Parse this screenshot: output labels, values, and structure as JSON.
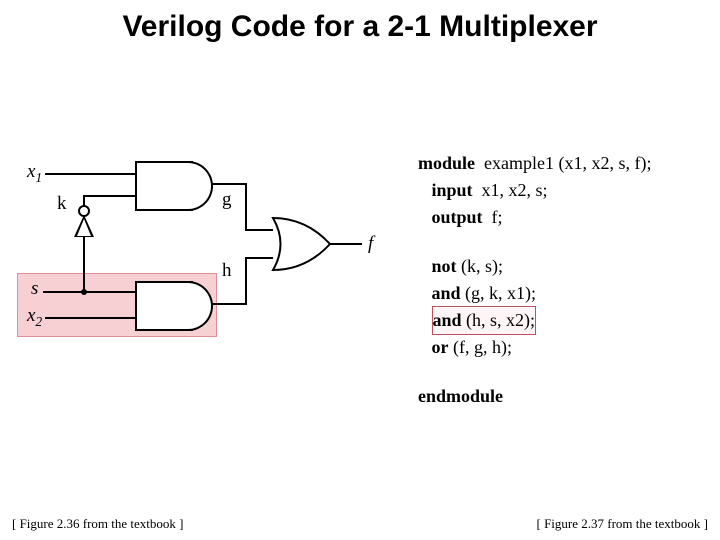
{
  "title": "Verilog Code for a 2-1 Multiplexer",
  "diagram": {
    "inputs": {
      "x1": "x",
      "x1sub": "1",
      "s": "s",
      "x2": "x",
      "x2sub": "2"
    },
    "wires": {
      "k": "k",
      "g": "g",
      "h": "h"
    },
    "output": "f"
  },
  "code": {
    "l1_kw": "module",
    "l1_rest": "  example1 (x1, x2, s, f);",
    "l2_kw": "input",
    "l2_rest": "  x1, x2, s;",
    "l3_kw": "output",
    "l3_rest": "  f;",
    "l4_kw": "not",
    "l4_rest": " (k, s);",
    "l5_kw": "and",
    "l5_rest": " (g, k, x1);",
    "l6_kw": "and",
    "l6_rest": " (h, s, x2);",
    "l7_kw": "or",
    "l7_rest": " (f, g, h);",
    "l8_kw": "endmodule"
  },
  "captions": {
    "left": "[ Figure 2.36 from the textbook ]",
    "right": "[ Figure 2.37 from the textbook ]"
  }
}
